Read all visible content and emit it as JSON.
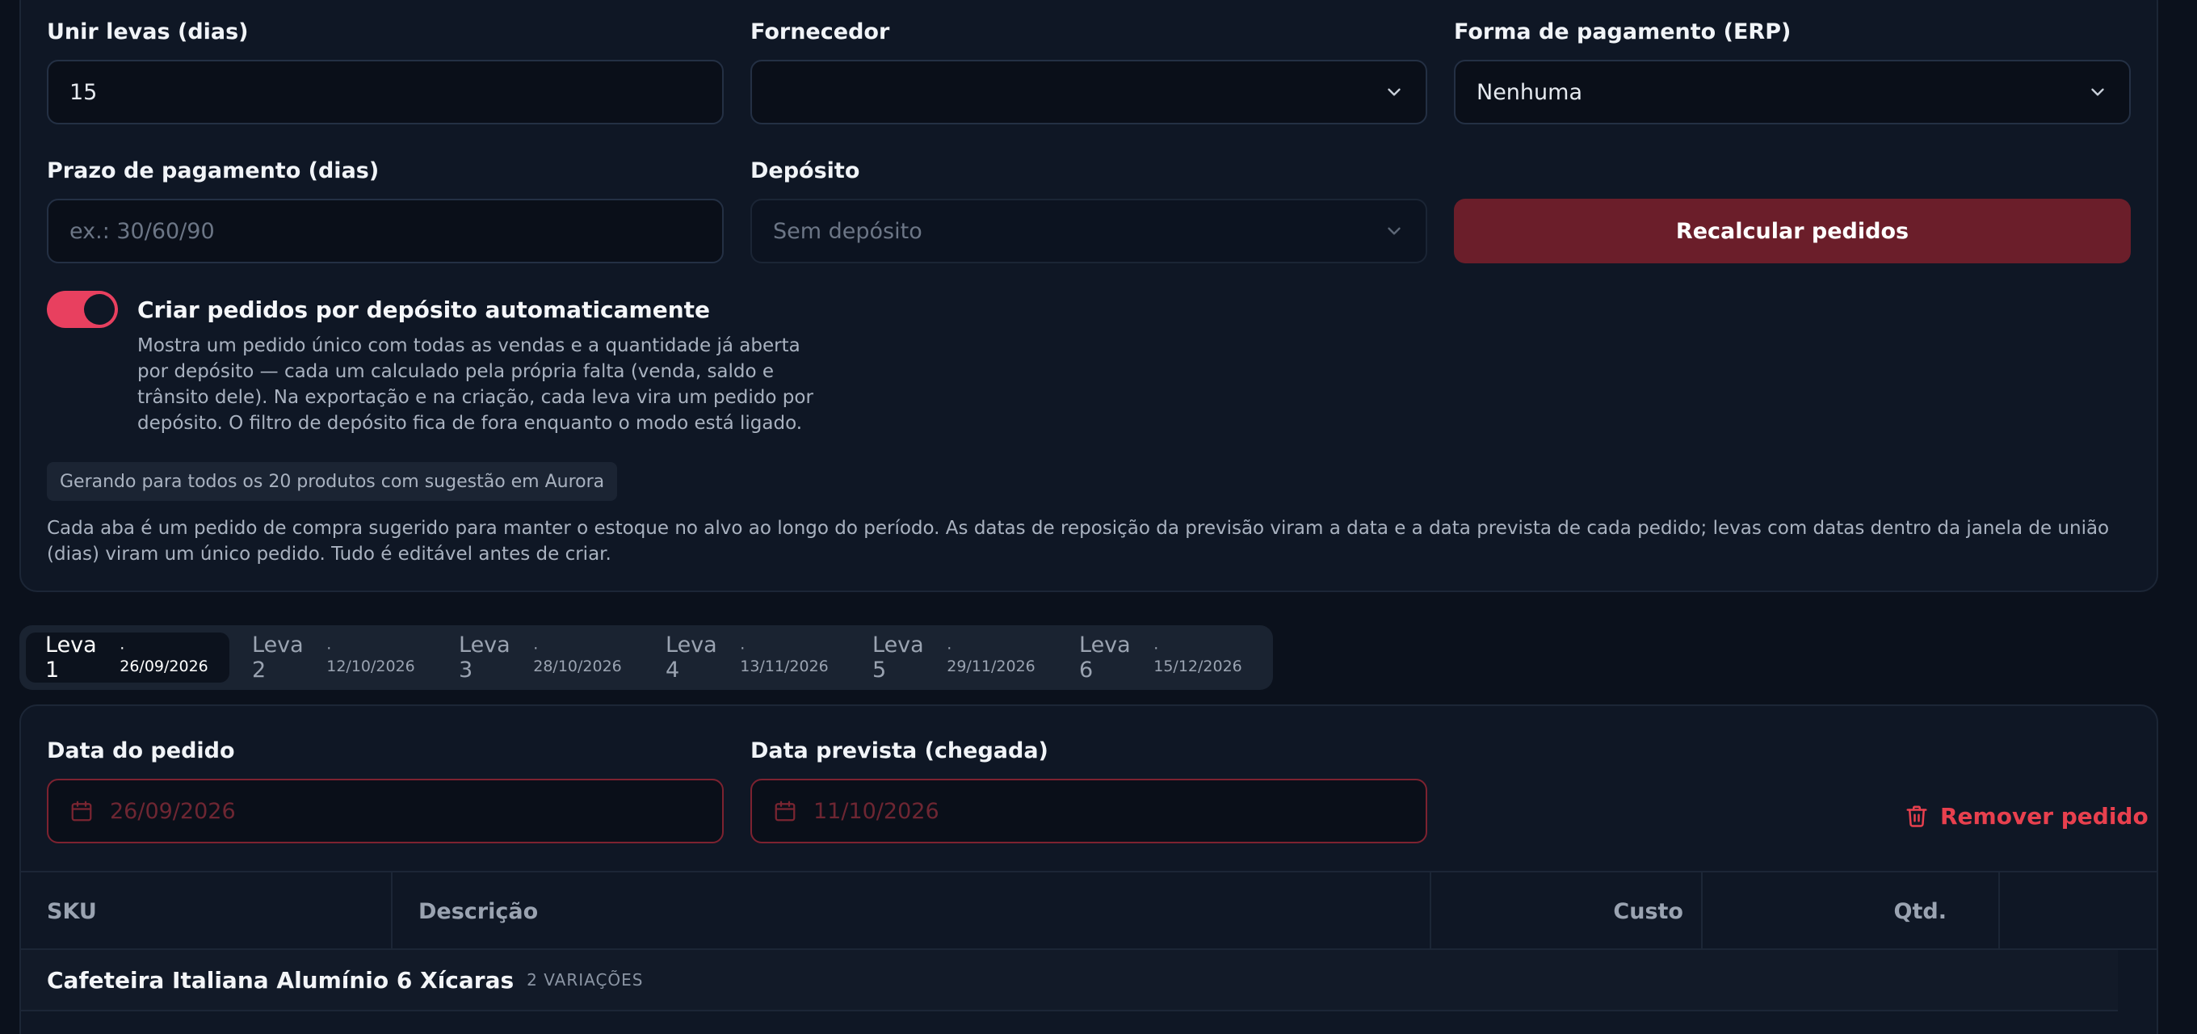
{
  "form": {
    "merge_label": "Unir levas (dias)",
    "merge_value": "15",
    "supplier_label": "Fornecedor",
    "supplier_value": "",
    "payment_method_label": "Forma de pagamento (ERP)",
    "payment_method_value": "Nenhuma",
    "payment_term_label": "Prazo de pagamento (dias)",
    "payment_term_placeholder": "ex.: 30/60/90",
    "deposit_label": "Depósito",
    "deposit_value": "Sem depósito",
    "recalc_label": "Recalcular pedidos"
  },
  "toggle": {
    "on": true,
    "title": "Criar pedidos por depósito automaticamente",
    "description": "Mostra um pedido único com todas as vendas e a quantidade já aberta por depósito — cada um calculado pela própria falta (venda, saldo e trânsito dele). Na exportação e na criação, cada leva vira um pedido por depósito. O filtro de depósito fica de fora enquanto o modo está ligado."
  },
  "chip": "Gerando para todos os 20 produtos com sugestão em Aurora",
  "info": "Cada aba é um pedido de compra sugerido para manter o estoque no alvo ao longo do período. As datas de reposição da previsão viram a data e a data prevista de cada pedido; levas com datas dentro da janela de união (dias) viram um único pedido. Tudo é editável antes de criar.",
  "tabs": [
    {
      "label": "Leva 1",
      "date": "· 26/09/2026",
      "active": true
    },
    {
      "label": "Leva 2",
      "date": "· 12/10/2026",
      "active": false
    },
    {
      "label": "Leva 3",
      "date": "· 28/10/2026",
      "active": false
    },
    {
      "label": "Leva 4",
      "date": "· 13/11/2026",
      "active": false
    },
    {
      "label": "Leva 5",
      "date": "· 29/11/2026",
      "active": false
    },
    {
      "label": "Leva 6",
      "date": "· 15/12/2026",
      "active": false
    }
  ],
  "order": {
    "order_date_label": "Data do pedido",
    "order_date_value": "26/09/2026",
    "arrival_date_label": "Data prevista (chegada)",
    "arrival_date_value": "11/10/2026",
    "remove_label": "Remover pedido"
  },
  "table": {
    "headers": {
      "sku": "SKU",
      "description": "Descrição",
      "cost": "Custo",
      "qty": "Qtd."
    },
    "group": {
      "name": "Cafeteira Italiana Alumínio 6 Xícaras",
      "count": "2 VARIAÇÕES"
    }
  },
  "colors": {
    "accent": "#e8405f",
    "primary_button": "#6b1e2a",
    "danger": "#e8404e",
    "background": "#0b111c",
    "panel": "#0f1725"
  }
}
